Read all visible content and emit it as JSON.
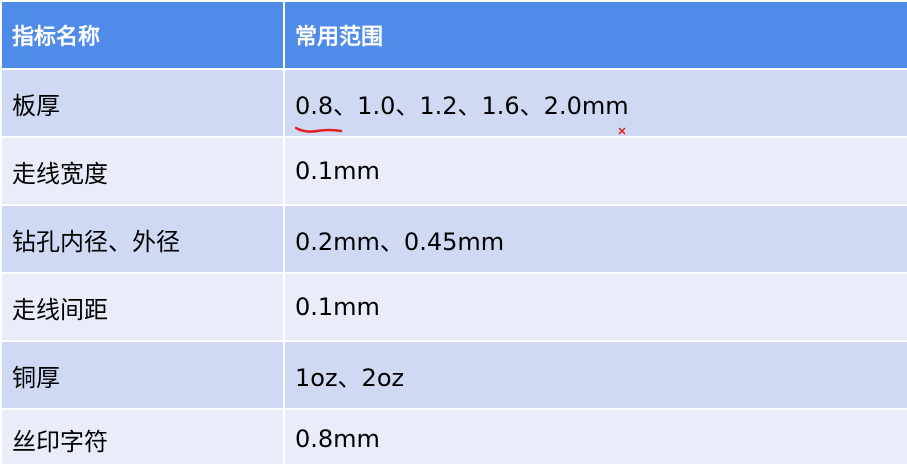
{
  "table": {
    "headers": [
      "指标名称",
      "常用范围"
    ],
    "rows": [
      {
        "name": "板厚",
        "value_first": "0.8",
        "value_rest": "、1.0、1.2、1.6、2.0mm"
      },
      {
        "name": "走线宽度",
        "value": "0.1mm"
      },
      {
        "name": "钻孔内径、外径",
        "value": "0.2mm、0.45mm"
      },
      {
        "name": "走线间距",
        "value": "0.1mm"
      },
      {
        "name": "铜厚",
        "value": "1oz、2oz"
      },
      {
        "name": "丝印字符",
        "value": "0.8mm"
      }
    ]
  },
  "colors": {
    "header_bg": "#4f8be9",
    "row_dark_bg": "#cfd9f3",
    "row_light_bg": "#e9edf9",
    "annotation_ink": "#e02020"
  },
  "annotations": [
    {
      "type": "handwritten-underline",
      "target": "table.rows.0.value_first",
      "color": "#e02020"
    }
  ]
}
